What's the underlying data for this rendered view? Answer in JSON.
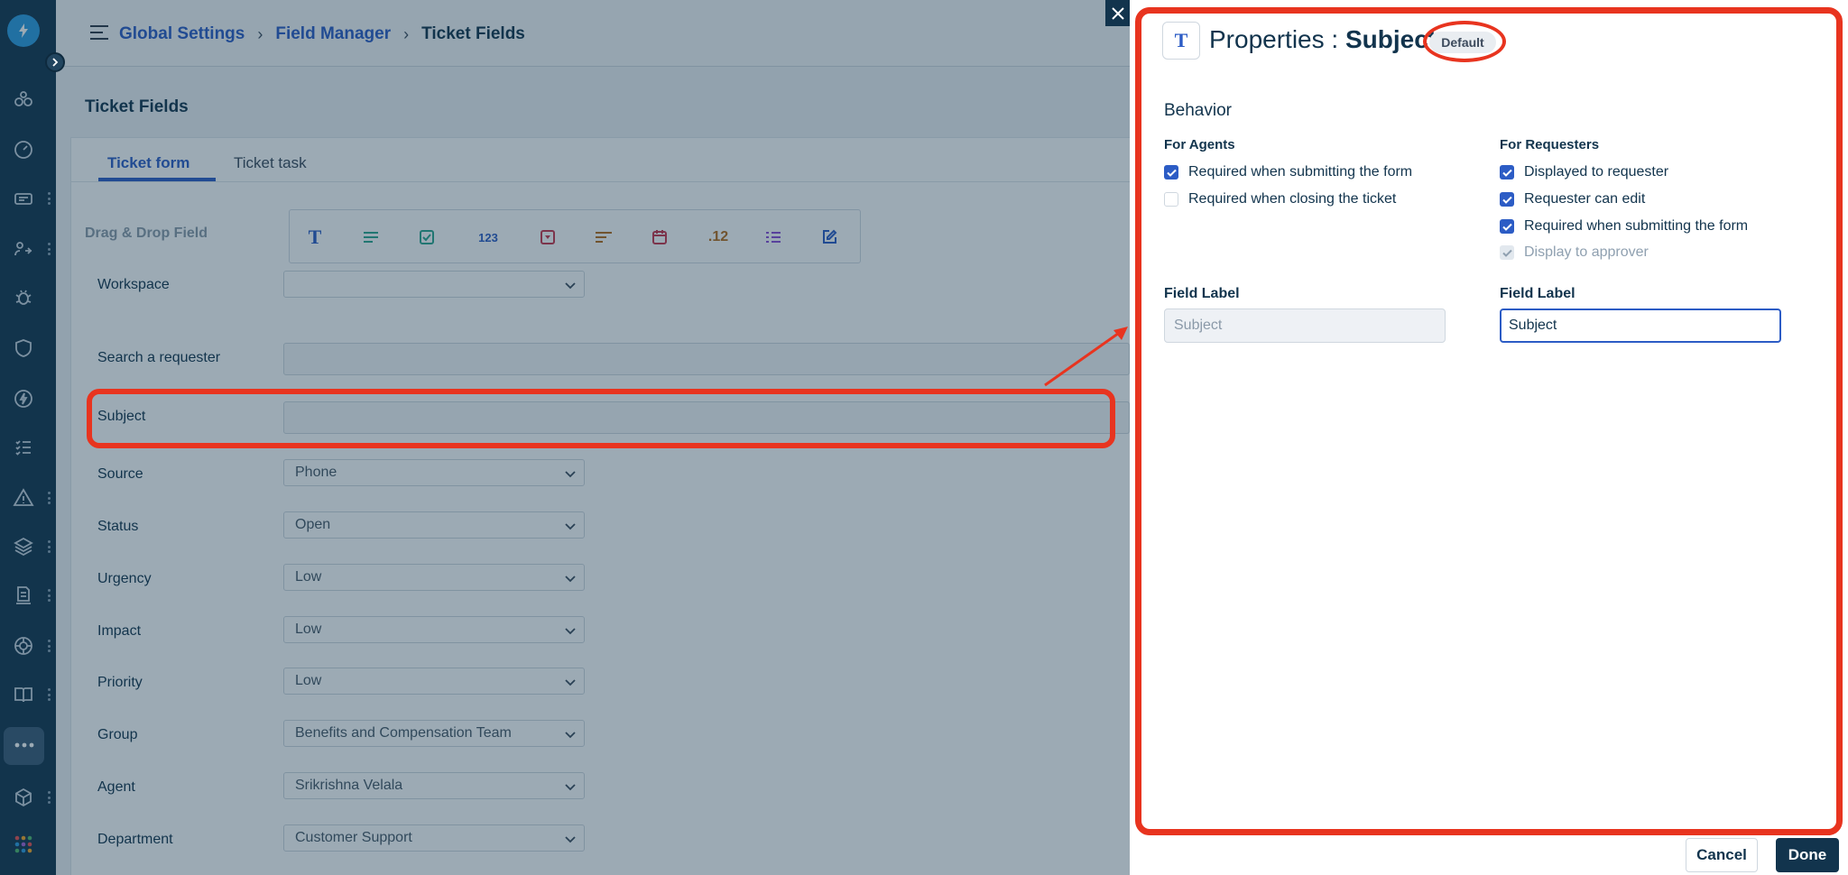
{
  "breadcrumb": {
    "item1": "Global Settings",
    "item2": "Field Manager",
    "current": "Ticket Fields",
    "sep": "›"
  },
  "page": {
    "title": "Ticket Fields"
  },
  "tabs": [
    {
      "label": "Ticket form"
    },
    {
      "label": "Ticket task"
    }
  ],
  "palette": {
    "label": "Drag & Drop Field",
    "num_label": "123",
    "decimal_label": ".12"
  },
  "form": {
    "fields": [
      {
        "label": "Workspace",
        "value": ""
      },
      {
        "label": "Search a requester"
      },
      {
        "label": "Subject"
      },
      {
        "label": "Source",
        "value": "Phone"
      },
      {
        "label": "Status",
        "value": "Open"
      },
      {
        "label": "Urgency",
        "value": "Low"
      },
      {
        "label": "Impact",
        "value": "Low"
      },
      {
        "label": "Priority",
        "value": "Low"
      },
      {
        "label": "Group",
        "value": "Benefits and Compensation Team"
      },
      {
        "label": "Agent",
        "value": "Srikrishna Velala"
      },
      {
        "label": "Department",
        "value": "Customer Support"
      }
    ]
  },
  "panel": {
    "type_icon": "T",
    "title_prefix": "Properties : ",
    "title_field": "Subject",
    "badge": "Default",
    "behavior_title": "Behavior",
    "agents": {
      "heading": "For Agents",
      "options": [
        {
          "label": "Required when submitting the form",
          "checked": true
        },
        {
          "label": "Required when closing the ticket",
          "checked": false
        }
      ]
    },
    "requesters": {
      "heading": "For Requesters",
      "options": [
        {
          "label": "Displayed to requester",
          "checked": true
        },
        {
          "label": "Requester can edit",
          "checked": true
        },
        {
          "label": "Required when submitting the form",
          "checked": true
        },
        {
          "label": "Display to approver",
          "checked": true,
          "disabled": true
        }
      ]
    },
    "field_label_agent": {
      "label": "Field Label",
      "value": "Subject"
    },
    "field_label_requester": {
      "label": "Field Label",
      "value": "Subject"
    }
  },
  "actions": {
    "cancel": "Cancel",
    "done": "Done"
  },
  "colors": {
    "accent": "#2c5cc5",
    "nav_bg": "#12344d",
    "highlight": "#e8341f"
  },
  "icons": {
    "close": "close-icon",
    "collapse": "chevron-right-icon"
  }
}
